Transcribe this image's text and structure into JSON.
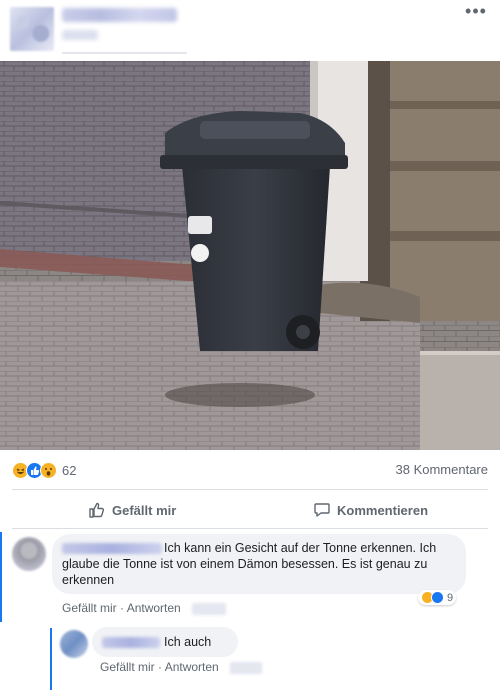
{
  "post": {
    "more_icon": "ellipsis-icon",
    "more_label": "•••"
  },
  "reactions": {
    "icons": [
      "haha-reaction-icon",
      "like-reaction-icon",
      "wow-reaction-icon"
    ],
    "count": "62",
    "comments_label": "38 Kommentare"
  },
  "actions": {
    "like_label": "Gefällt mir",
    "comment_label": "Kommentieren"
  },
  "comments": [
    {
      "text": "Ich kann ein Gesicht auf der Tonne erkennen. Ich glaube die Tonne ist von einem Dämon besessen. Es ist genau zu erkennen",
      "like_label": "Gefällt mir",
      "reply_label": "Antworten",
      "separator": "·",
      "reaction_count": "9",
      "replies": [
        {
          "text": "Ich auch",
          "like_label": "Gefällt mir",
          "reply_label": "Antworten",
          "separator": "·"
        }
      ]
    }
  ],
  "colors": {
    "accent": "#1877f2",
    "muted_text": "#606770",
    "bubble": "#f0f2f5",
    "divider": "#dadde1"
  }
}
